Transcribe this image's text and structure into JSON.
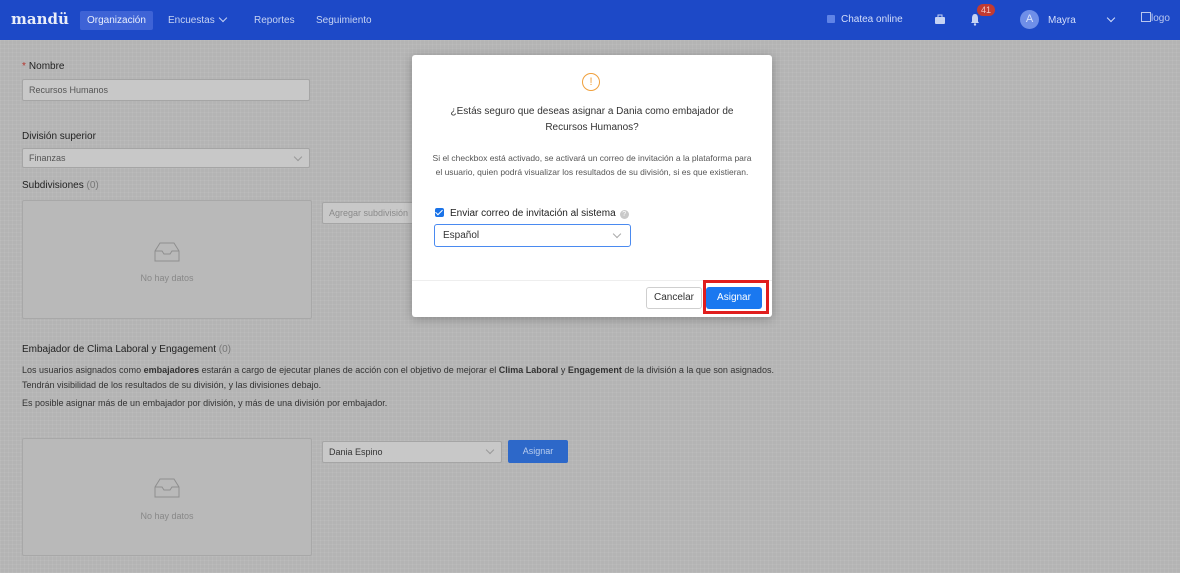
{
  "nav": {
    "brand": "mandü",
    "items": [
      "Organización",
      "Encuestas",
      "Reportes",
      "Seguimiento"
    ],
    "chat": "Chatea online",
    "badge": "41",
    "avatar_letter": "A",
    "user": "Mayra",
    "logo_alt": "logo",
    "colors": {
      "bar": "#1d49c7",
      "badge": "#c23a30"
    }
  },
  "form": {
    "name_label": "Nombre",
    "name_required": "*",
    "name_value": "Recursos Humanos",
    "parent_label": "División superior",
    "parent_value": "Finanzas",
    "subdiv_label": "Subdivisiones",
    "subdiv_count": "(0)",
    "subdiv_empty": "No hay datos",
    "subdiv_add_placeholder": "Agregar subdivisión"
  },
  "ambassadors": {
    "title": "Embajador de Clima Laboral y Engagement",
    "count": "(0)",
    "para1_a": "Los usuarios asignados como ",
    "para1_b": "embajadores",
    "para1_c": " estarán a cargo de ejecutar planes de acción con el objetivo de mejorar el ",
    "para1_d": "Clima Laboral",
    "para1_e": " y ",
    "para1_f": "Engagement",
    "para1_g": " de la división a la que son asignados. Tendrán visibilidad de los resultados de su división, y las divisiones debajo.",
    "para2": "Es posible asignar más de un embajador por división, y más de una división por embajador.",
    "empty": "No hay datos",
    "selected_user": "Dania Espino",
    "assign_label": "Asignar"
  },
  "modal": {
    "icon": "!",
    "title": "¿Estás seguro que deseas asignar a Dania como embajador de Recursos Humanos?",
    "description": "Si el checkbox está activado, se activará un correo de invitación a la plataforma para el usuario, quien podrá visualizar los resultados de su división, si es que existieran.",
    "checkbox_label": "Enviar correo de invitación al sistema",
    "checkbox_checked": true,
    "language_value": "Español",
    "cancel_label": "Cancelar",
    "assign_label": "Asignar",
    "colors": {
      "primary": "#1a78f0",
      "warning": "#f0a03c",
      "highlight": "#e01e1e"
    }
  }
}
